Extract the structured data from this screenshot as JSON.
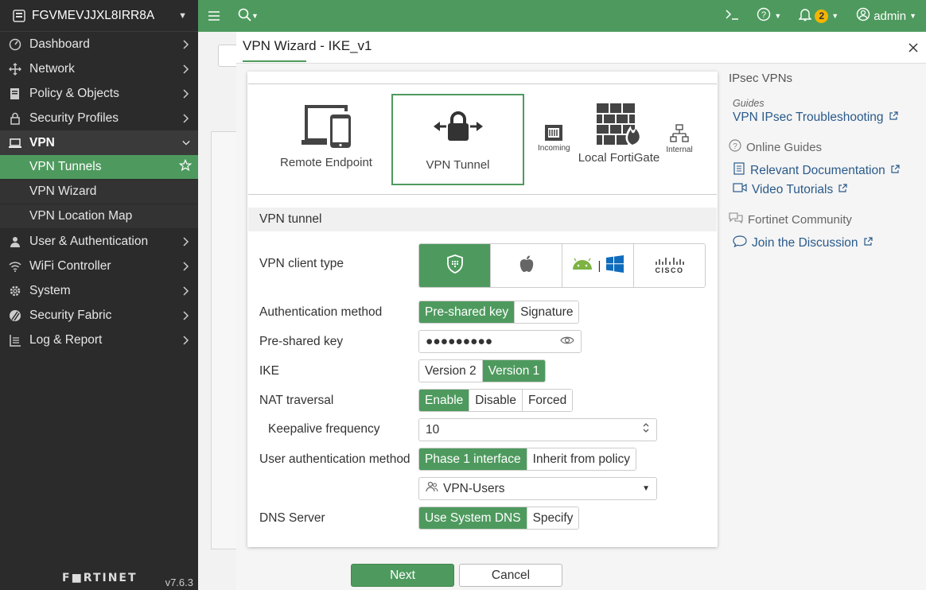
{
  "sidebar": {
    "device_name": "FGVMEVJJXL8IRR8A",
    "items": [
      {
        "label": "Dashboard",
        "icon": "dashboard-icon"
      },
      {
        "label": "Network",
        "icon": "network-icon"
      },
      {
        "label": "Policy & Objects",
        "icon": "policy-icon"
      },
      {
        "label": "Security Profiles",
        "icon": "lock-icon"
      },
      {
        "label": "VPN",
        "icon": "laptop-icon"
      }
    ],
    "vpn_sub": [
      {
        "label": "VPN Tunnels"
      },
      {
        "label": "VPN Wizard"
      },
      {
        "label": "VPN Location Map"
      }
    ],
    "items_after": [
      {
        "label": "User & Authentication",
        "icon": "user-icon"
      },
      {
        "label": "WiFi Controller",
        "icon": "wifi-icon"
      },
      {
        "label": "System",
        "icon": "gear-icon"
      },
      {
        "label": "Security Fabric",
        "icon": "fabric-icon"
      },
      {
        "label": "Log & Report",
        "icon": "report-icon"
      }
    ],
    "brand": "F■RTINET",
    "version": "v7.6.3"
  },
  "topbar": {
    "notifications_count": "2",
    "user": "admin"
  },
  "dialog": {
    "title": "VPN Wizard - IKE_v1",
    "topology": {
      "remote_endpoint": "Remote Endpoint",
      "vpn_tunnel": "VPN Tunnel",
      "local_fortigate": "Local FortiGate",
      "incoming": "Incoming",
      "internal": "Internal"
    },
    "section_title": "VPN tunnel",
    "labels": {
      "client_type": "VPN client type",
      "auth_method": "Authentication method",
      "psk": "Pre-shared key",
      "ike": "IKE",
      "nat": "NAT traversal",
      "keepalive": "Keepalive frequency",
      "user_auth": "User authentication method",
      "dns": "DNS Server"
    },
    "auth_options": [
      "Pre-shared key",
      "Signature"
    ],
    "psk_value": "●●●●●●●●●",
    "ike_options": [
      "Version 2",
      "Version 1"
    ],
    "nat_options": [
      "Enable",
      "Disable",
      "Forced"
    ],
    "keepalive_value": "10",
    "user_auth_options": [
      "Phase 1 interface",
      "Inherit from policy"
    ],
    "user_group": "VPN-Users",
    "dns_options": [
      "Use System DNS",
      "Specify"
    ],
    "cisco_label": "CISCO",
    "next_label": "Next",
    "cancel_label": "Cancel"
  },
  "help": {
    "title": "IPsec VPNs",
    "guides_label": "Guides",
    "troubleshooting": "VPN IPsec Troubleshooting",
    "online_guides": "Online Guides",
    "relevant_docs": "Relevant Documentation",
    "video_tutorials": "Video Tutorials",
    "community": "Fortinet Community",
    "join": "Join the Discussion"
  }
}
